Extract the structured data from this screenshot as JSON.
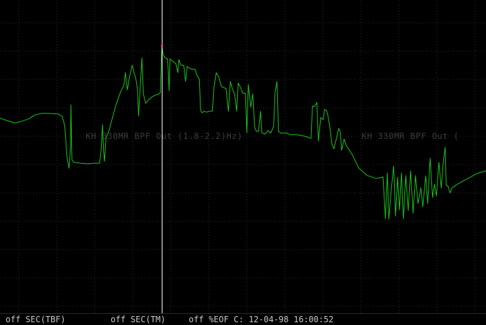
{
  "colors": {
    "background": "#000000",
    "grid": "#2e2e2e",
    "trace": "#19c819",
    "cursor": "#ffffff",
    "cursor_marker": "#ff4040",
    "label": "#3c3c3c",
    "status_text": "#c8c8c8"
  },
  "trace_labels": {
    "label_1": "KH 330MR BPF Out (1.8-2.2)Hz)",
    "label_2": "KH 330MR BPF Out ("
  },
  "status_bar": {
    "field_1": "off SEC(TBF)",
    "field_2": "off SEC(TM)",
    "field_3": "off %EOF C: 12-04-98 16:00:52"
  },
  "chart_data": {
    "type": "line",
    "grid": true,
    "xlim": [
      0,
      1
    ],
    "ylim": [
      0,
      1
    ],
    "cursor_x": 0.333,
    "series": [
      {
        "points": [
          [
            0.0,
            0.377
          ],
          [
            0.015,
            0.385
          ],
          [
            0.03,
            0.393
          ],
          [
            0.045,
            0.387
          ],
          [
            0.06,
            0.379
          ],
          [
            0.07,
            0.368
          ],
          [
            0.085,
            0.362
          ],
          [
            0.1,
            0.362
          ],
          [
            0.12,
            0.364
          ],
          [
            0.128,
            0.372
          ],
          [
            0.133,
            0.4
          ],
          [
            0.138,
            0.503
          ],
          [
            0.142,
            0.537
          ],
          [
            0.145,
            0.47
          ],
          [
            0.146,
            0.335
          ],
          [
            0.148,
            0.51
          ],
          [
            0.152,
            0.518
          ],
          [
            0.165,
            0.521
          ],
          [
            0.18,
            0.523
          ],
          [
            0.195,
            0.521
          ],
          [
            0.205,
            0.521
          ],
          [
            0.208,
            0.48
          ],
          [
            0.211,
            0.398
          ],
          [
            0.213,
            0.48
          ],
          [
            0.215,
            0.515
          ],
          [
            0.218,
            0.441
          ],
          [
            0.225,
            0.414
          ],
          [
            0.232,
            0.372
          ],
          [
            0.238,
            0.338
          ],
          [
            0.248,
            0.294
          ],
          [
            0.255,
            0.271
          ],
          [
            0.258,
            0.232
          ],
          [
            0.262,
            0.287
          ],
          [
            0.266,
            0.249
          ],
          [
            0.272,
            0.208
          ],
          [
            0.276,
            0.233
          ],
          [
            0.28,
            0.255
          ],
          [
            0.283,
            0.286
          ],
          [
            0.285,
            0.37
          ],
          [
            0.288,
            0.29
          ],
          [
            0.292,
            0.185
          ],
          [
            0.295,
            0.3
          ],
          [
            0.3,
            0.33
          ],
          [
            0.305,
            0.32
          ],
          [
            0.312,
            0.31
          ],
          [
            0.32,
            0.303
          ],
          [
            0.325,
            0.302
          ],
          [
            0.33,
            0.296
          ],
          [
            0.333,
            0.147
          ],
          [
            0.336,
            0.175
          ],
          [
            0.34,
            0.185
          ],
          [
            0.345,
            0.188
          ],
          [
            0.348,
            0.29
          ],
          [
            0.35,
            0.188
          ],
          [
            0.356,
            0.196
          ],
          [
            0.362,
            0.203
          ],
          [
            0.366,
            0.232
          ],
          [
            0.368,
            0.19
          ],
          [
            0.372,
            0.208
          ],
          [
            0.378,
            0.208
          ],
          [
            0.382,
            0.26
          ],
          [
            0.385,
            0.212
          ],
          [
            0.392,
            0.22
          ],
          [
            0.398,
            0.221
          ],
          [
            0.402,
            0.223
          ],
          [
            0.405,
            0.24
          ],
          [
            0.41,
            0.252
          ],
          [
            0.413,
            0.353
          ],
          [
            0.416,
            0.36
          ],
          [
            0.42,
            0.355
          ],
          [
            0.425,
            0.358
          ],
          [
            0.432,
            0.355
          ],
          [
            0.437,
            0.355
          ],
          [
            0.44,
            0.282
          ],
          [
            0.445,
            0.232
          ],
          [
            0.45,
            0.245
          ],
          [
            0.455,
            0.275
          ],
          [
            0.46,
            0.28
          ],
          [
            0.465,
            0.282
          ],
          [
            0.47,
            0.355
          ],
          [
            0.474,
            0.26
          ],
          [
            0.478,
            0.283
          ],
          [
            0.483,
            0.302
          ],
          [
            0.487,
            0.355
          ],
          [
            0.49,
            0.265
          ],
          [
            0.495,
            0.28
          ],
          [
            0.5,
            0.298
          ],
          [
            0.505,
            0.298
          ],
          [
            0.508,
            0.424
          ],
          [
            0.511,
            0.27
          ],
          [
            0.516,
            0.342
          ],
          [
            0.52,
            0.3
          ],
          [
            0.524,
            0.407
          ],
          [
            0.528,
            0.42
          ],
          [
            0.532,
            0.419
          ],
          [
            0.536,
            0.355
          ],
          [
            0.539,
            0.424
          ],
          [
            0.545,
            0.428
          ],
          [
            0.552,
            0.417
          ],
          [
            0.557,
            0.425
          ],
          [
            0.563,
            0.403
          ],
          [
            0.566,
            0.295
          ],
          [
            0.57,
            0.26
          ],
          [
            0.573,
            0.419
          ],
          [
            0.578,
            0.425
          ],
          [
            0.588,
            0.424
          ],
          [
            0.598,
            0.43
          ],
          [
            0.61,
            0.43
          ],
          [
            0.622,
            0.433
          ],
          [
            0.632,
            0.437
          ],
          [
            0.64,
            0.442
          ],
          [
            0.643,
            0.338
          ],
          [
            0.647,
            0.34
          ],
          [
            0.652,
            0.327
          ],
          [
            0.655,
            0.45
          ],
          [
            0.66,
            0.375
          ],
          [
            0.665,
            0.382
          ],
          [
            0.668,
            0.349
          ],
          [
            0.672,
            0.353
          ],
          [
            0.675,
            0.371
          ],
          [
            0.68,
            0.42
          ],
          [
            0.683,
            0.46
          ],
          [
            0.687,
            0.475
          ],
          [
            0.692,
            0.443
          ],
          [
            0.697,
            0.41
          ],
          [
            0.7,
            0.42
          ],
          [
            0.703,
            0.48
          ],
          [
            0.708,
            0.444
          ],
          [
            0.713,
            0.466
          ],
          [
            0.725,
            0.494
          ],
          [
            0.738,
            0.536
          ],
          [
            0.755,
            0.56
          ],
          [
            0.775,
            0.57
          ],
          [
            0.788,
            0.565
          ],
          [
            0.793,
            0.698
          ],
          [
            0.797,
            0.552
          ],
          [
            0.8,
            0.7
          ],
          [
            0.805,
            0.607
          ],
          [
            0.81,
            0.53
          ],
          [
            0.814,
            0.69
          ],
          [
            0.818,
            0.566
          ],
          [
            0.822,
            0.67
          ],
          [
            0.826,
            0.552
          ],
          [
            0.83,
            0.698
          ],
          [
            0.835,
            0.56
          ],
          [
            0.84,
            0.672
          ],
          [
            0.845,
            0.545
          ],
          [
            0.85,
            0.68
          ],
          [
            0.855,
            0.56
          ],
          [
            0.86,
            0.65
          ],
          [
            0.866,
            0.6
          ],
          [
            0.87,
            0.66
          ],
          [
            0.876,
            0.561
          ],
          [
            0.88,
            0.65
          ],
          [
            0.885,
            0.505
          ],
          [
            0.89,
            0.63
          ],
          [
            0.894,
            0.588
          ],
          [
            0.898,
            0.625
          ],
          [
            0.903,
            0.518
          ],
          [
            0.908,
            0.6
          ],
          [
            0.912,
            0.52
          ],
          [
            0.916,
            0.47
          ],
          [
            0.918,
            0.59
          ],
          [
            0.922,
            0.595
          ],
          [
            0.926,
            0.616
          ],
          [
            0.93,
            0.6
          ],
          [
            0.94,
            0.589
          ],
          [
            0.955,
            0.576
          ],
          [
            0.965,
            0.568
          ],
          [
            0.98,
            0.555
          ],
          [
            1.0,
            0.545
          ]
        ]
      }
    ]
  }
}
